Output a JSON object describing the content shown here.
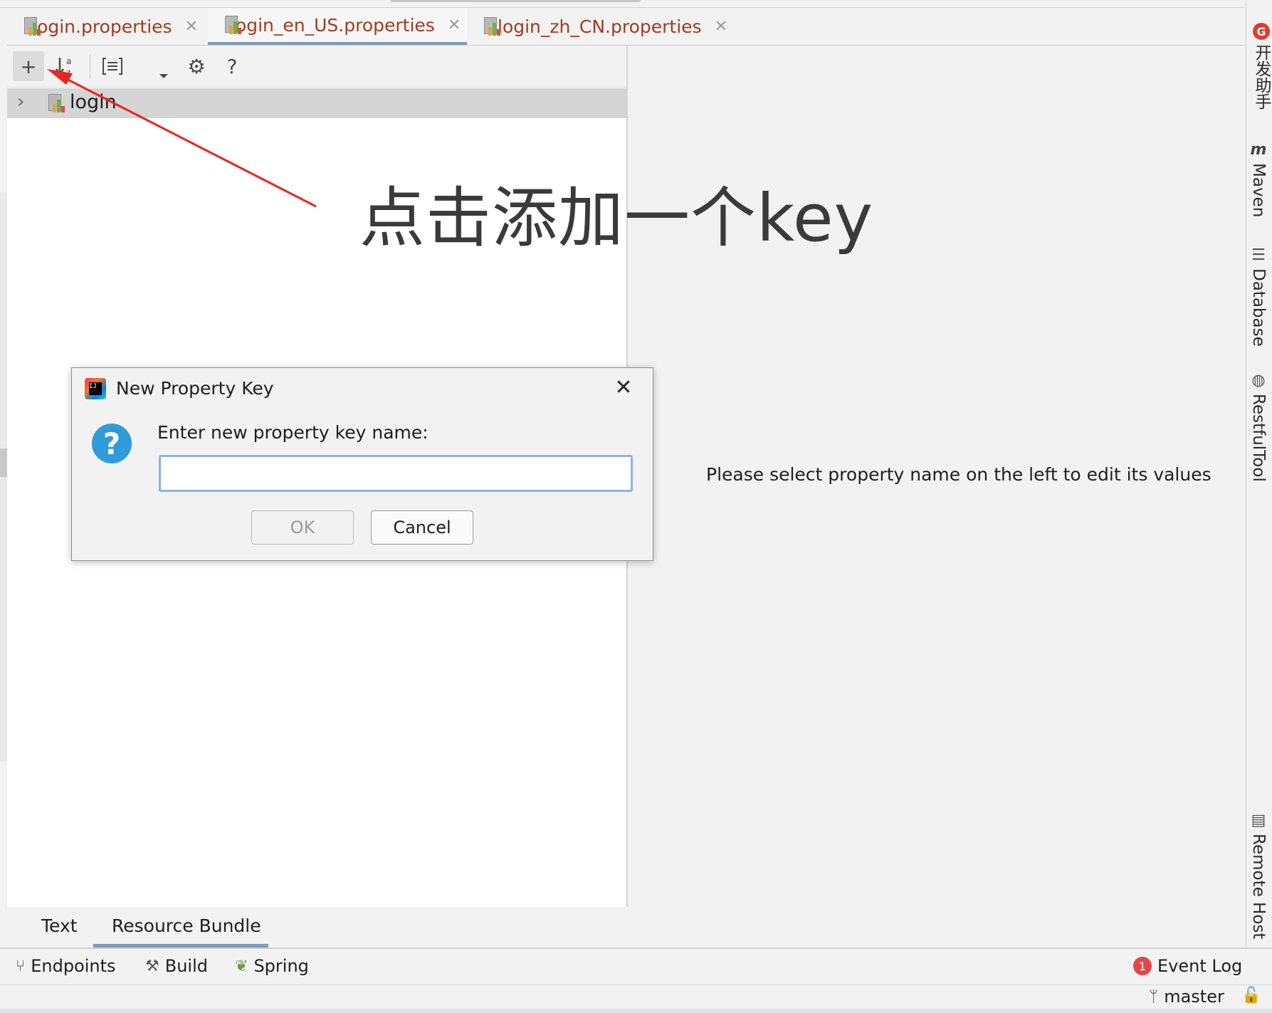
{
  "tabs": [
    {
      "label": "login.properties",
      "active": false
    },
    {
      "label": "login_en_US.properties",
      "active": true
    },
    {
      "label": "login_zh_CN.properties",
      "active": false
    }
  ],
  "toolbar": {
    "add_label": "+",
    "help_label": "?"
  },
  "tree": {
    "root_label": "login"
  },
  "annotation": {
    "text": "点击添加一个key",
    "color": "#e8261f"
  },
  "right_panel": {
    "hint": "Please select property name on the left to edit its values"
  },
  "right_sidebar": [
    {
      "label": "开发助手",
      "icon": "developer-assistant-icon"
    },
    {
      "label": "Maven",
      "icon": "maven-icon"
    },
    {
      "label": "Database",
      "icon": "database-icon"
    },
    {
      "label": "RestfulTool",
      "icon": "globe-icon"
    },
    {
      "label": "Remote Host",
      "icon": "remote-host-icon"
    }
  ],
  "bottom_tabs": [
    {
      "label": "Text",
      "active": false
    },
    {
      "label": "Resource Bundle",
      "active": true
    }
  ],
  "tool_windows": {
    "endpoints": "Endpoints",
    "build": "Build",
    "spring": "Spring",
    "event_log": "Event Log",
    "event_count": "1"
  },
  "status": {
    "branch": "master"
  },
  "dialog": {
    "title": "New Property Key",
    "prompt": "Enter new property key name:",
    "input_value": "",
    "ok_label": "OK",
    "cancel_label": "Cancel"
  },
  "colors": {
    "accent": "#7c99b8",
    "file_tab_text": "#a23c1e",
    "question_icon": "#2f9bd8",
    "focus_border": "#8ab4e3"
  }
}
